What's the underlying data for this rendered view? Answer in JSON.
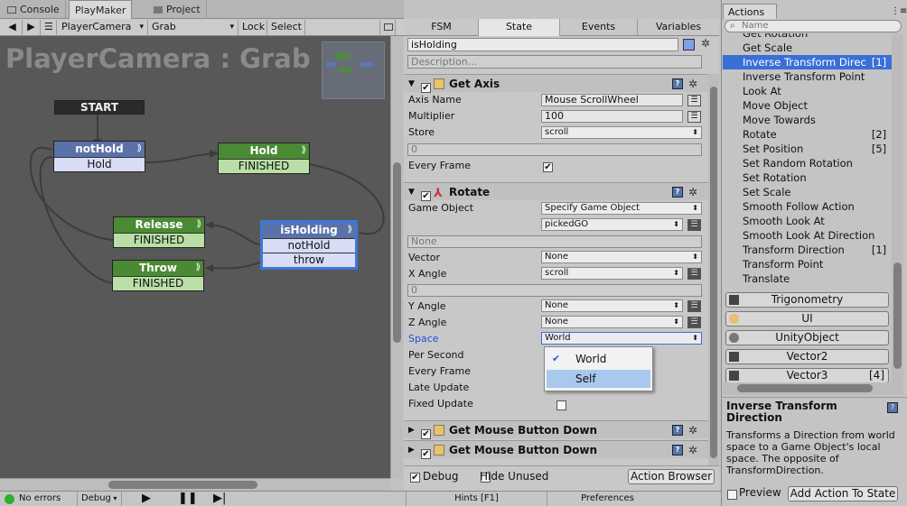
{
  "tabs": {
    "console": "Console",
    "playmaker": "PlayMaker",
    "project": "Project",
    "fsm": "FSM",
    "state": "State",
    "events": "Events",
    "variables": "Variables",
    "actions": "Actions"
  },
  "toolbar": {
    "object": "PlayerCamera",
    "fsm": "Grab",
    "lock": "Lock",
    "select": "Select"
  },
  "graph": {
    "title": "PlayerCamera : Grab",
    "start": "START",
    "nodes": {
      "nothold": {
        "name": "notHold",
        "t1": "Hold"
      },
      "hold": {
        "name": "Hold",
        "t1": "FINISHED"
      },
      "release": {
        "name": "Release",
        "t1": "FINISHED"
      },
      "throw": {
        "name": "Throw",
        "t1": "FINISHED"
      },
      "isholding": {
        "name": "isHolding",
        "t1": "notHold",
        "t2": "throw"
      }
    }
  },
  "state": {
    "name": "isHolding",
    "description_placeholder": "Description...",
    "get_axis": {
      "title": "Get Axis",
      "axis_name_label": "Axis Name",
      "axis_name": "Mouse ScrollWheel",
      "multiplier_label": "Multiplier",
      "multiplier": "100",
      "store_label": "Store",
      "store": "scroll",
      "store_value": "0",
      "every_frame_label": "Every Frame"
    },
    "rotate": {
      "title": "Rotate",
      "game_object_label": "Game Object",
      "game_object": "Specify Game Object",
      "game_object_var": "pickedGO",
      "none_placeholder": "None",
      "vector_label": "Vector",
      "vector": "None",
      "x_angle_label": "X Angle",
      "x_angle": "scroll",
      "x_value": "0",
      "y_angle_label": "Y Angle",
      "y_angle": "None",
      "z_angle_label": "Z Angle",
      "z_angle": "None",
      "space_label": "Space",
      "space": "World",
      "space_options": [
        "World",
        "Self"
      ],
      "per_second_label": "Per Second",
      "every_frame_label": "Every Frame",
      "late_update_label": "Late Update",
      "fixed_update_label": "Fixed Update"
    },
    "collapsed_actions": [
      "Get Mouse Button Down",
      "Get Mouse Button Down"
    ],
    "debug_label": "Debug",
    "hide_unused_label": "Hide Unused",
    "action_browser": "Action Browser"
  },
  "actions_panel": {
    "search_placeholder": "Name",
    "items": [
      {
        "label": "Get Rotation",
        "badge": ""
      },
      {
        "label": "Get Scale",
        "badge": ""
      },
      {
        "label": "Inverse Transform Direc",
        "badge": "[1]"
      },
      {
        "label": "Inverse Transform Point",
        "badge": ""
      },
      {
        "label": "Look At",
        "badge": ""
      },
      {
        "label": "Move Object",
        "badge": ""
      },
      {
        "label": "Move Towards",
        "badge": ""
      },
      {
        "label": "Rotate",
        "badge": "[2]"
      },
      {
        "label": "Set Position",
        "badge": "[5]"
      },
      {
        "label": "Set Random Rotation",
        "badge": ""
      },
      {
        "label": "Set Rotation",
        "badge": ""
      },
      {
        "label": "Set Scale",
        "badge": ""
      },
      {
        "label": "Smooth Follow Action",
        "badge": ""
      },
      {
        "label": "Smooth Look At",
        "badge": ""
      },
      {
        "label": "Smooth Look At Direction",
        "badge": ""
      },
      {
        "label": "Transform Direction",
        "badge": "[1]"
      },
      {
        "label": "Transform Point",
        "badge": ""
      },
      {
        "label": "Translate",
        "badge": ""
      }
    ],
    "categories": [
      {
        "label": "Trigonometry",
        "badge": ""
      },
      {
        "label": "UI",
        "badge": ""
      },
      {
        "label": "UnityObject",
        "badge": ""
      },
      {
        "label": "Vector2",
        "badge": ""
      },
      {
        "label": "Vector3",
        "badge": "[4]"
      }
    ],
    "detail_title": "Inverse Transform Direction",
    "detail_text": "Transforms a Direction from world space to a Game Object's local space. The opposite of TransformDirection.",
    "preview_label": "Preview",
    "add_action": "Add Action To State"
  },
  "status": {
    "errors": "No errors",
    "debug": "Debug",
    "hints": "Hints [F1]",
    "preferences": "Preferences"
  },
  "colors": {
    "selected_state": "#3d78d8",
    "node_header_blue": "#5b72a8",
    "node_header_green": "#4a8a34",
    "list_selection": "#3a6fd8"
  }
}
